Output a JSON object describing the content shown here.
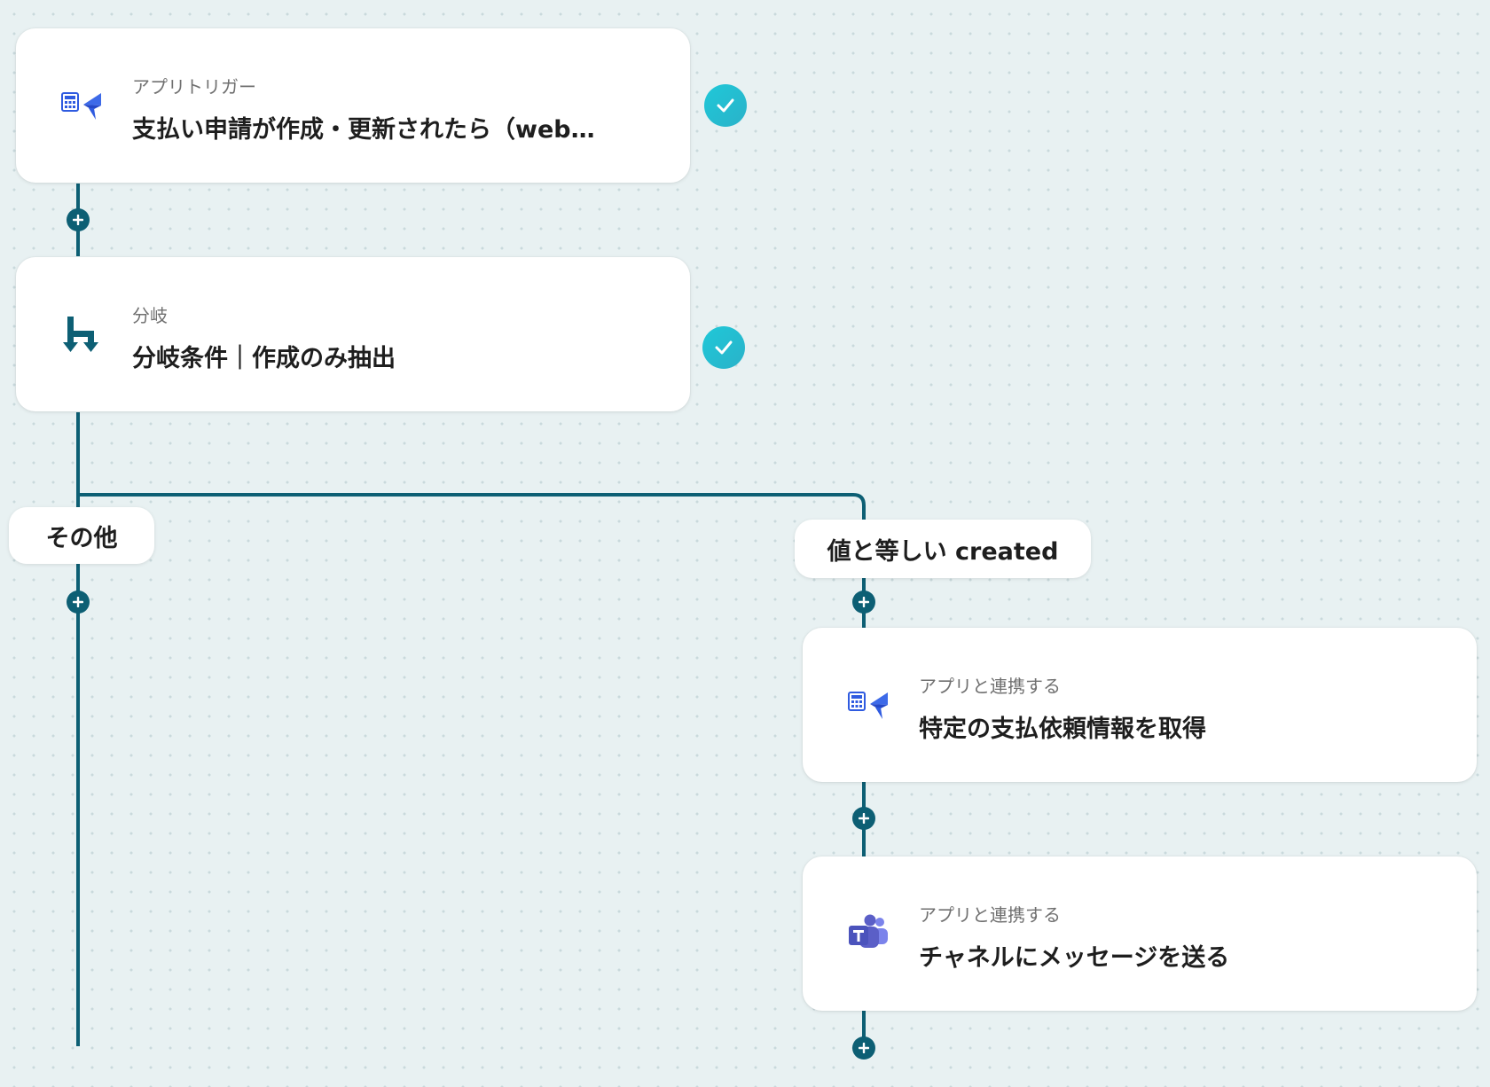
{
  "flow": {
    "trigger": {
      "icon": "payment-approval-app-icon",
      "subtitle": "アプリトリガー",
      "title": "支払い申請が作成・更新されたら（web…",
      "status": "completed"
    },
    "branch": {
      "icon": "branch-icon",
      "subtitle": "分岐",
      "title": "分岐条件｜作成のみ抽出",
      "status": "completed"
    },
    "branches": [
      {
        "label": "その他",
        "steps": []
      },
      {
        "label": "値と等しい created",
        "steps": [
          {
            "icon": "payment-approval-app-icon",
            "subtitle": "アプリと連携する",
            "title": "特定の支払依頼情報を取得"
          },
          {
            "icon": "microsoft-teams-icon",
            "subtitle": "アプリと連携する",
            "title": "チャネルにメッセージを送る"
          }
        ]
      }
    ]
  },
  "colors": {
    "connector": "#0d5f74",
    "check": "#25c0d2",
    "app_icon_blue": "#2f5be0",
    "teams_purple": "#5b5fc7"
  }
}
